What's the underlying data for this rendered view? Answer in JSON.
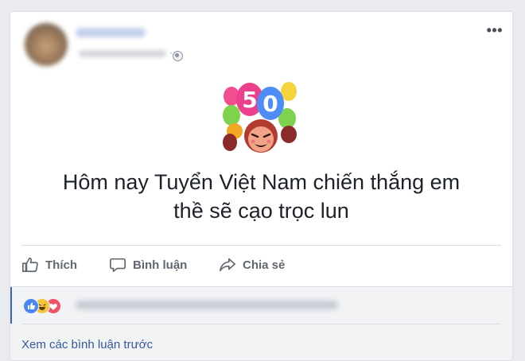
{
  "post": {
    "text_line1": "Hôm nay Tuyển Việt Nam chiến thắng em",
    "text_line2": "thề sẽ cạo trọc lun",
    "sticker_number": "50",
    "more_label": "•••"
  },
  "actions": {
    "like": "Thích",
    "comment": "Bình luận",
    "share": "Chia sẻ"
  },
  "comments": {
    "view_previous": "Xem các bình luận trước"
  },
  "icons": {
    "like": "like-icon",
    "comment": "comment-icon",
    "share": "share-icon",
    "globe": "globe-icon",
    "more": "more-icon",
    "reactions": [
      "like-reaction-icon",
      "haha-reaction-icon",
      "love-reaction-icon"
    ]
  },
  "colors": {
    "link": "#365899",
    "accent": "#4267b2",
    "text": "#1d2129",
    "muted": "#606770"
  }
}
